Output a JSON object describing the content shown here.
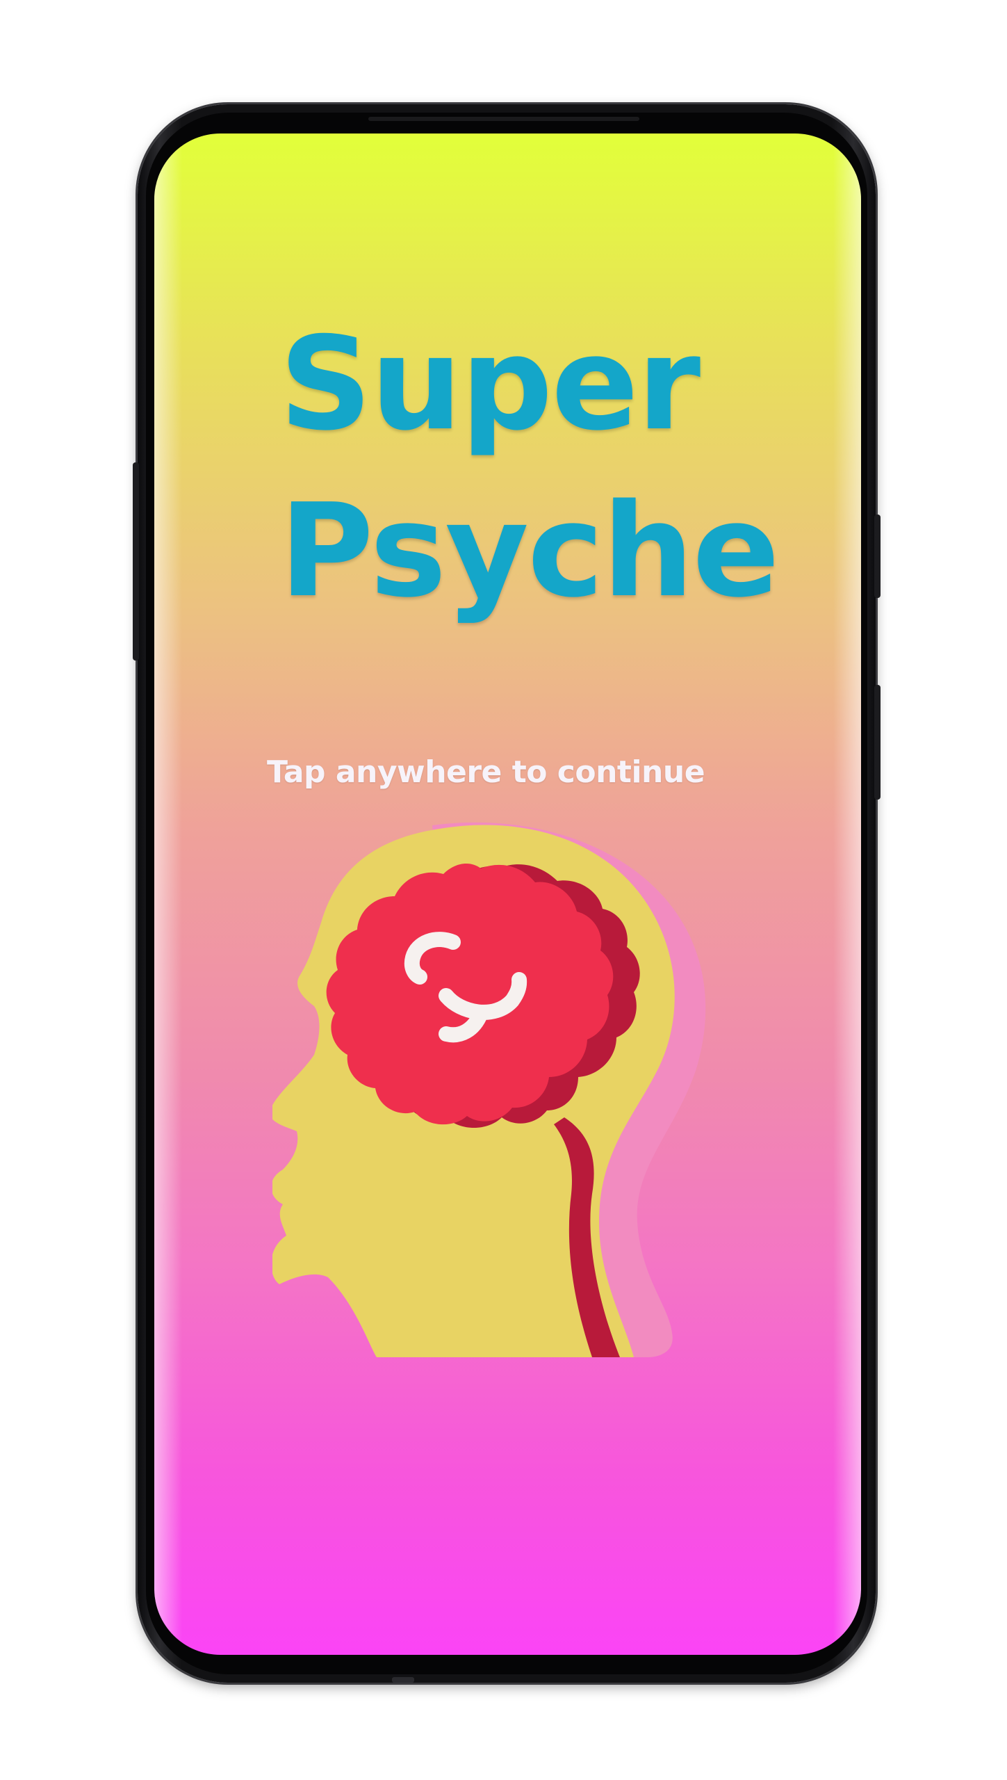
{
  "splash": {
    "title_line1": "Super",
    "title_line2": "Psyche",
    "tap_hint": "Tap anywhere to continue"
  },
  "icons": {
    "illustration": "head-with-brain-icon"
  },
  "colors": {
    "title": "#14a6c9",
    "hint_text": "#f7f3fa",
    "gradient_top": "#e2ff3a",
    "gradient_bottom": "#fb44f6",
    "head": "#e8d363",
    "head_shadow": "#f28bc0",
    "brain": "#ef2f4d",
    "brain_shadow": "#b81a3a",
    "brain_mark": "#f6f1ef"
  }
}
